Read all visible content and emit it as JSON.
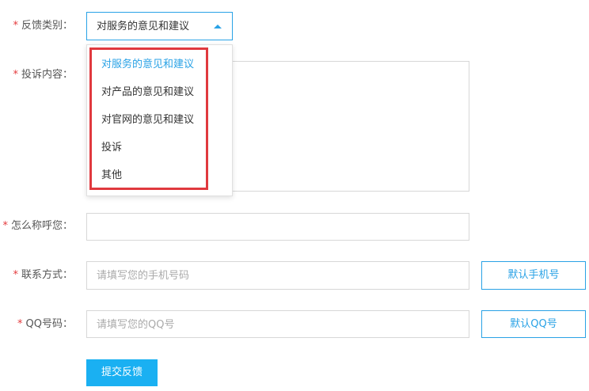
{
  "form": {
    "required_mark": "*",
    "feedback_type": {
      "label": "反馈类别：",
      "selected": "对服务的意见和建议",
      "options": [
        "对服务的意见和建议",
        "对产品的意见和建议",
        "对官网的意见和建议",
        "投诉",
        "其他"
      ]
    },
    "content": {
      "label": "投诉内容："
    },
    "name": {
      "label": "怎么称呼您："
    },
    "contact": {
      "label": "联系方式：",
      "placeholder": "请填写您的手机号码",
      "default_button": "默认手机号"
    },
    "qq": {
      "label": "QQ号码：",
      "placeholder": "请填写您的QQ号",
      "default_button": "默认QQ号"
    },
    "submit_label": "提交反馈"
  },
  "colors": {
    "accent": "#29a2e6",
    "primary_button": "#1ab0f2",
    "required": "#e4393c",
    "highlight_box": "#e0393e"
  },
  "icons": {
    "select_caret": "caret-up-icon"
  }
}
